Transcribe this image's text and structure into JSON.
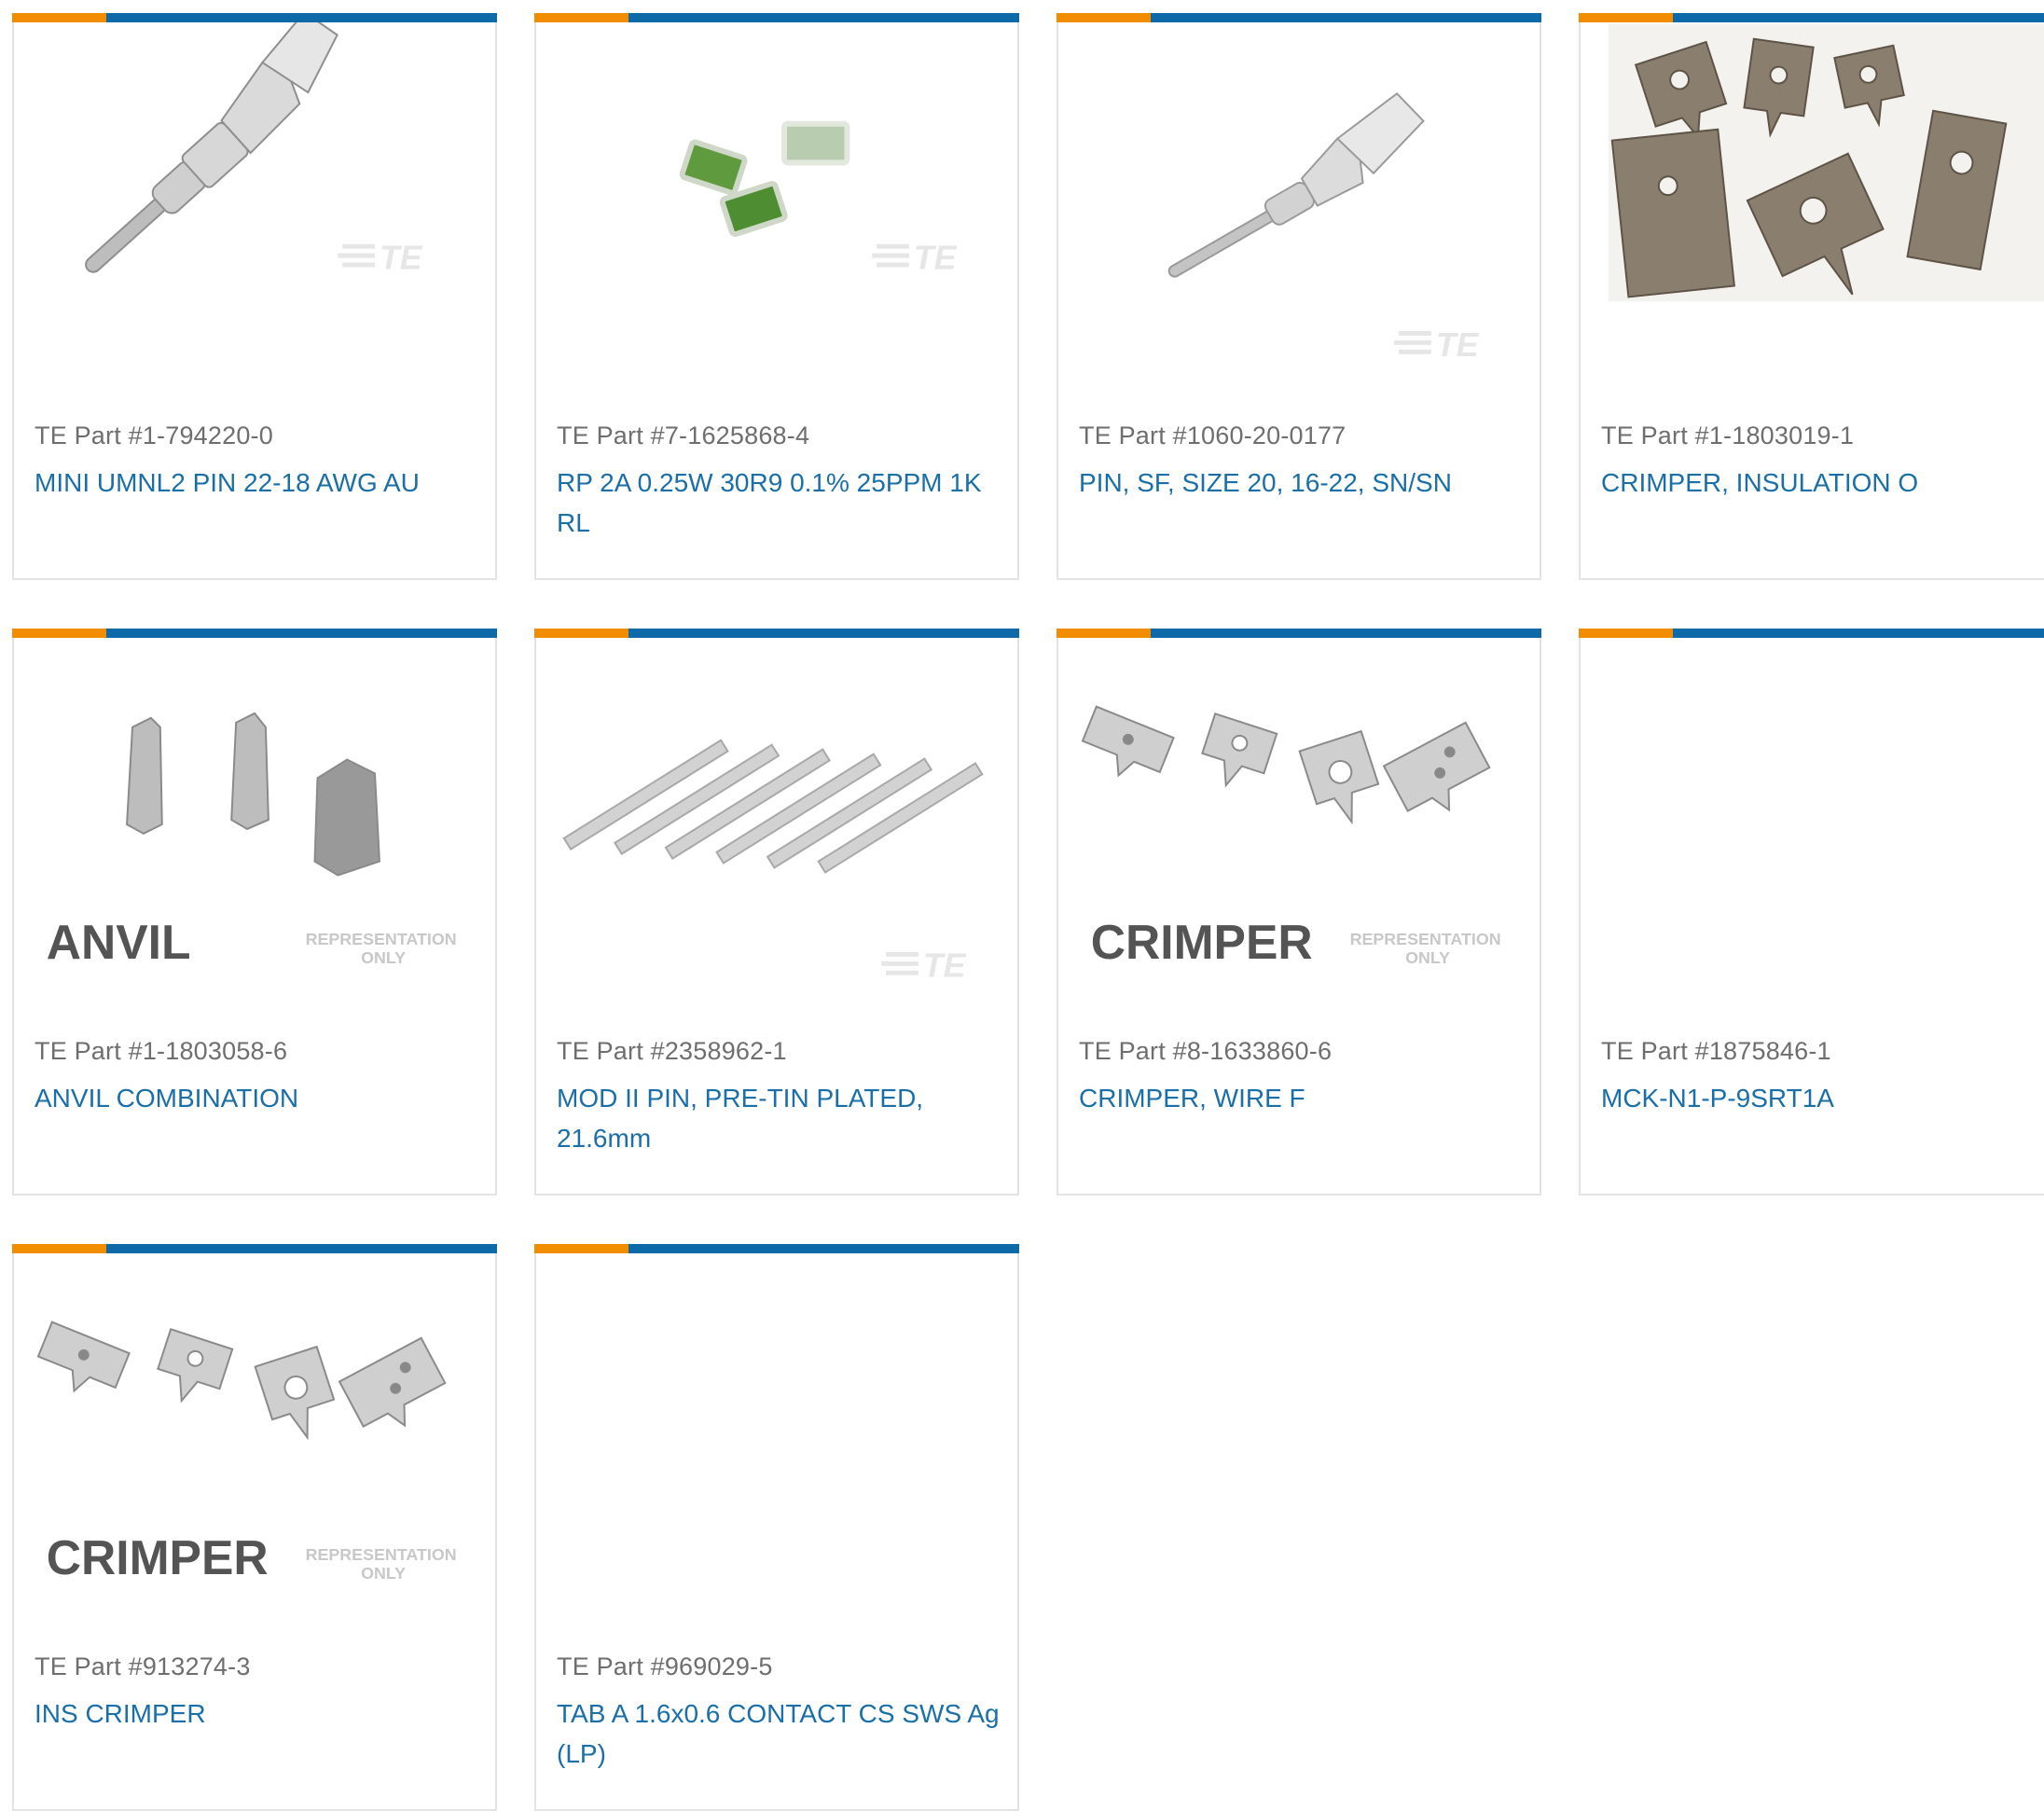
{
  "colors": {
    "accent_orange": "#f28c00",
    "accent_blue": "#0e69a8",
    "link_blue": "#1a6fa8",
    "part_gray": "#6e6e6e",
    "border": "#e3e3e3"
  },
  "products": [
    {
      "part_number": "TE Part #1-794220-0",
      "title": "MINI UMNL2 PIN 22-18 AWG AU",
      "image": "crimp-pin-icon"
    },
    {
      "part_number": "TE Part #7-1625868-4",
      "title": "RP 2A 0.25W 30R9 0.1% 25PPM 1K RL",
      "image": "chip-resistor-icon"
    },
    {
      "part_number": "TE Part #1060-20-0177",
      "title": "PIN, SF, SIZE 20, 16-22, SN/SN",
      "image": "crimp-pin-icon"
    },
    {
      "part_number": "TE Part #1-1803019-1",
      "title": "CRIMPER, INSULATION O",
      "image": "crimper-plates-photo"
    },
    {
      "part_number": "TE Part #1-1803058-6",
      "title": "ANVIL COMBINATION",
      "image": "anvil-icon",
      "image_caption": "ANVIL",
      "image_note": [
        "REPRESENTATION",
        "ONLY"
      ]
    },
    {
      "part_number": "TE Part #2358962-1",
      "title": "MOD II PIN, PRE-TIN PLATED, 21.6mm",
      "image": "pin-strip-icon"
    },
    {
      "part_number": "TE Part #8-1633860-6",
      "title": "CRIMPER, WIRE F",
      "image": "crimper-icon",
      "image_caption": "CRIMPER",
      "image_note": [
        "REPRESENTATION",
        "ONLY"
      ]
    },
    {
      "part_number": "TE Part #1875846-1",
      "title": "MCK-N1-P-9SRT1A",
      "image": "no-image"
    },
    {
      "part_number": "TE Part #913274-3",
      "title": "INS CRIMPER",
      "image": "crimper-icon",
      "image_caption": "CRIMPER",
      "image_note": [
        "REPRESENTATION",
        "ONLY"
      ]
    },
    {
      "part_number": "TE Part #969029-5",
      "title": "TAB A 1.6x0.6 CONTACT CS SWS Ag (LP)",
      "image": "no-image"
    }
  ]
}
